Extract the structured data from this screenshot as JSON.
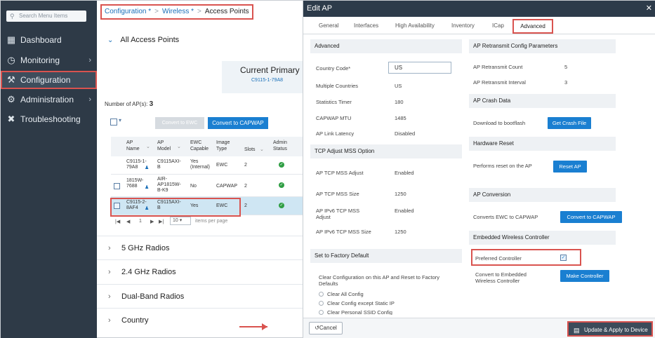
{
  "sidebar": {
    "search_placeholder": "Search Menu Items",
    "items": [
      {
        "label": "Dashboard",
        "icon": "dashboard-icon"
      },
      {
        "label": "Monitoring",
        "icon": "monitoring-icon"
      },
      {
        "label": "Configuration",
        "icon": "wrench-icon"
      },
      {
        "label": "Administration",
        "icon": "gear-icon"
      },
      {
        "label": "Troubleshooting",
        "icon": "tools-icon"
      }
    ]
  },
  "breadcrumb": {
    "c1": "Configuration *",
    "c2": "Wireless *",
    "c3": "Access Points",
    "sep": ">"
  },
  "main": {
    "all_aps": "All Access Points",
    "current_primary": "Current Primary",
    "current_primary_sub": "C9115-1-79A8",
    "num_aps_label": "Number of AP(s):",
    "num_aps": "3",
    "btn_to_ewc": "Convert to EWC",
    "btn_to_capwap": "Convert to CAPWAP",
    "columns": [
      "AP Name",
      "AP Model",
      "EWC Capable",
      "Image Type",
      "Slots",
      "Admin Status"
    ],
    "rows": [
      {
        "name": "C9115-1-79A8",
        "model": "C9115AXI-B",
        "ewc": "Yes (Internal)",
        "type": "EWC",
        "slots": "2"
      },
      {
        "name": "1815W-7688",
        "model": "AIR-AP1815W-B-K9",
        "ewc": "No",
        "type": "CAPWAP",
        "slots": "2"
      },
      {
        "name": "C9115-2-8AF4",
        "model": "C9115AXI-B",
        "ewc": "Yes",
        "type": "EWC",
        "slots": "2"
      }
    ],
    "pager_page": "1",
    "pager_size": "10",
    "pager_text": "items per page",
    "accordions": [
      "5 GHz Radios",
      "2.4 GHz Radios",
      "Dual-Band Radios",
      "Country"
    ]
  },
  "modal": {
    "title": "Edit AP",
    "tabs": [
      "General",
      "Interfaces",
      "High Availability",
      "Inventory",
      "ICap",
      "Advanced"
    ],
    "advanced": {
      "title": "Advanced",
      "country_label": "Country Code*",
      "country_value": "US",
      "multiple_countries_label": "Multiple Countries",
      "multiple_countries_value": "US",
      "stats_timer_label": "Statistics Timer",
      "stats_timer_value": "180",
      "mtu_label": "CAPWAP MTU",
      "mtu_value": "1485",
      "link_latency_label": "AP Link Latency",
      "link_latency_value": "Disabled"
    },
    "tcp": {
      "title": "TCP Adjust MSS Option",
      "mss_adjust_label": "AP TCP MSS Adjust",
      "mss_adjust_value": "Enabled",
      "mss_size_label": "AP TCP MSS Size",
      "mss_size_value": "1250",
      "v6_adjust_label": "AP IPv6 TCP MSS Adjust",
      "v6_adjust_value": "Enabled",
      "v6_size_label": "AP IPv6 TCP MSS Size",
      "v6_size_value": "1250"
    },
    "factory": {
      "title": "Set to Factory Default",
      "desc": "Clear Configuration on this AP and Reset to Factory Defaults",
      "opt1": "Clear All Config",
      "opt2": "Clear Config except Static IP",
      "opt3": "Clear Personal SSID Config"
    },
    "retransmit": {
      "title": "AP Retransmit Config Parameters",
      "count_label": "AP Retransmit Count",
      "count_value": "5",
      "interval_label": "AP Retransmit Interval",
      "interval_value": "3"
    },
    "crash": {
      "title": "AP Crash Data",
      "label": "Download to bootflash",
      "button": "Get Crash File"
    },
    "reset": {
      "title": "Hardware Reset",
      "label": "Performs reset on the AP",
      "button": "Reset AP"
    },
    "conversion": {
      "title": "AP Conversion",
      "label": "Converts EWC to CAPWAP",
      "button": "Convert to CAPWAP"
    },
    "ewc": {
      "title": "Embedded Wireless Controller",
      "preferred_label": "Preferred Controller",
      "convert_label": "Convert to Embedded Wireless Controller",
      "button": "Make Controller"
    },
    "cancel": "Cancel",
    "update": "Update & Apply to Device"
  },
  "colors": {
    "sidebar_bg": "#2e3a47",
    "accent": "#1a7fd1",
    "highlight": "#d9534f",
    "status_ok": "#2f9e44"
  }
}
